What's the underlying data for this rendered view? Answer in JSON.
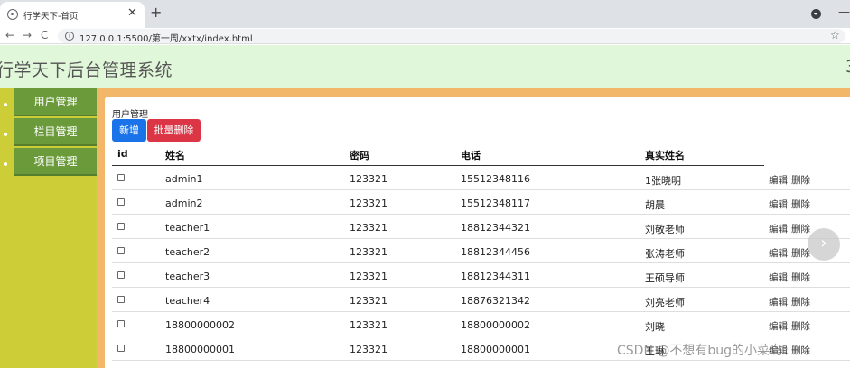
{
  "browser": {
    "tab_title": "行学天下-首页",
    "tab_close": "✕",
    "new_tab": "+",
    "back": "←",
    "forward": "→",
    "reload": "C",
    "info": "i",
    "url": "127.0.0.1:5500/第一周/xxtx/index.html",
    "star": "☆",
    "minimize": "—"
  },
  "header": {
    "title": "行学天下后台管理系统",
    "right_edge": "3"
  },
  "sidebar": {
    "items": [
      {
        "label": "用户管理"
      },
      {
        "label": "栏目管理"
      },
      {
        "label": "项目管理"
      }
    ]
  },
  "main": {
    "panel_title": "用户管理",
    "buttons": {
      "add": "新增",
      "batch_delete": "批量删除"
    },
    "columns": [
      "id",
      "姓名",
      "密码",
      "电话",
      "真实姓名"
    ],
    "actions": {
      "edit": "编辑",
      "delete": "删除"
    },
    "rows": [
      {
        "name": "admin1",
        "password": "123321",
        "phone": "15512348116",
        "real_name": "1张晓明"
      },
      {
        "name": "admin2",
        "password": "123321",
        "phone": "15512348117",
        "real_name": "胡晨"
      },
      {
        "name": "teacher1",
        "password": "123321",
        "phone": "18812344321",
        "real_name": "刘敬老师"
      },
      {
        "name": "teacher2",
        "password": "123321",
        "phone": "18812344456",
        "real_name": "张涛老师"
      },
      {
        "name": "teacher3",
        "password": "123321",
        "phone": "18812344311",
        "real_name": "王硕导师"
      },
      {
        "name": "teacher4",
        "password": "123321",
        "phone": "18876321342",
        "real_name": "刘亮老师"
      },
      {
        "name": "18800000002",
        "password": "123321",
        "phone": "18800000002",
        "real_name": "刘晓"
      },
      {
        "name": "18800000001",
        "password": "123321",
        "phone": "18800000001",
        "real_name": "王琳"
      }
    ]
  },
  "overlay": {
    "next_arrow": "›",
    "watermark": "CSDN @不想有bug的小菜鸟"
  },
  "colors": {
    "header_bg": "#e1f7da",
    "sidebar_bg": "#cdcd37",
    "menu_item_bg": "#6a9a3a",
    "content_frame": "#f2b769",
    "add_button": "#1a73e8",
    "delete_button": "#dc3545"
  }
}
